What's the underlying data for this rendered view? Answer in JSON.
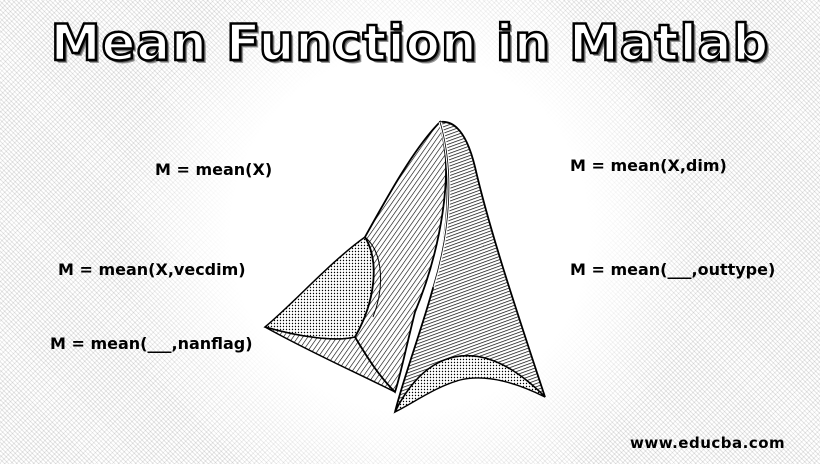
{
  "title": "Mean Function in Matlab",
  "syntax": {
    "mean_x": "M = mean(X)",
    "mean_dim": "M = mean(X,dim)",
    "mean_vecdim": "M = mean(X,vecdim)",
    "mean_outtype": "M = mean(___,outtype)",
    "mean_nanflag": "M = mean(___,nanflag)"
  },
  "watermark": "www.educba.com",
  "logo": {
    "icon": "matlab-membrane-icon"
  }
}
